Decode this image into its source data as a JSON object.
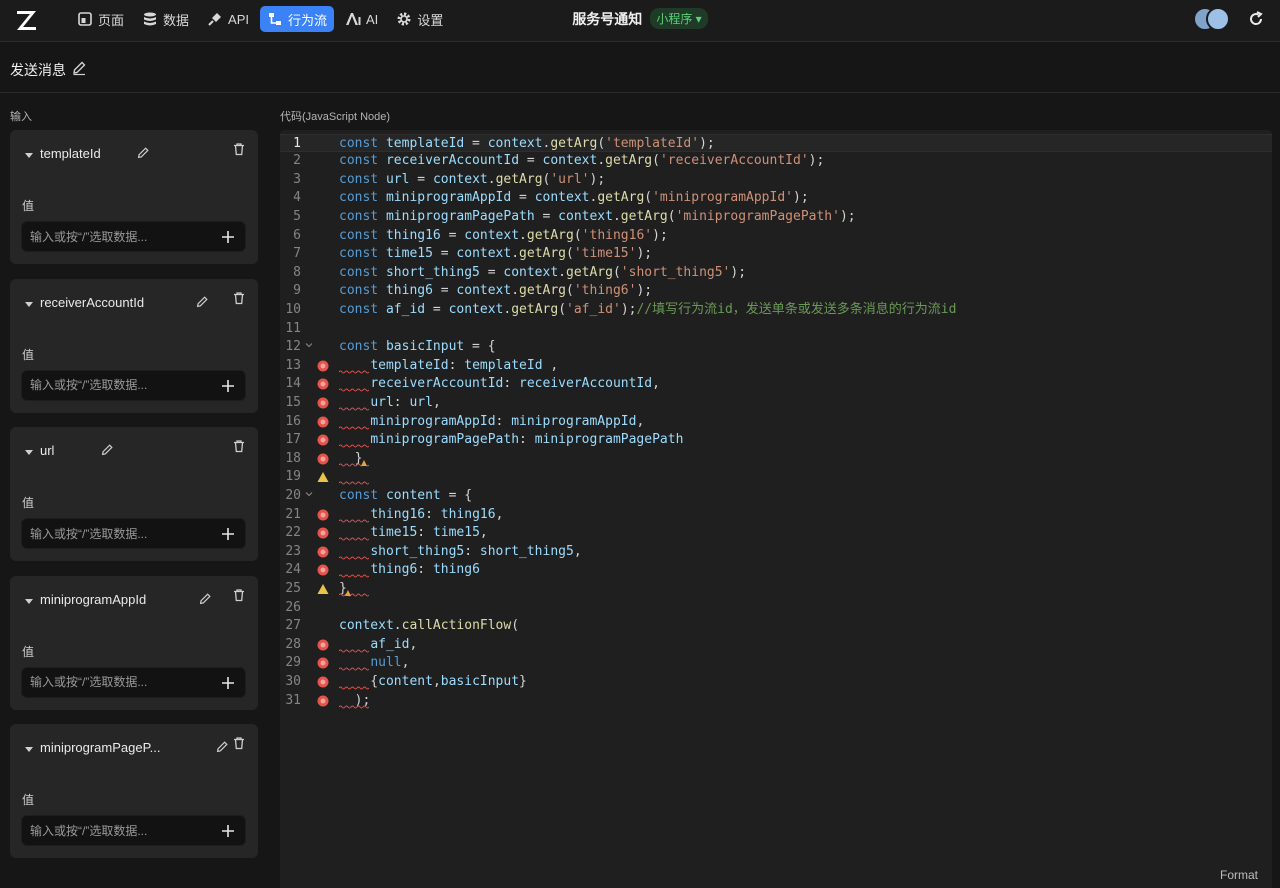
{
  "nav": {
    "items": [
      {
        "label": "页面",
        "icon": "page-icon"
      },
      {
        "label": "数据",
        "icon": "database-icon"
      },
      {
        "label": "API",
        "icon": "plug-icon"
      },
      {
        "label": "行为流",
        "icon": "flow-icon",
        "active": true
      },
      {
        "label": "AI",
        "icon": "ai-icon"
      },
      {
        "label": "设置",
        "icon": "gear-icon"
      }
    ]
  },
  "header": {
    "app_title": "服务号通知",
    "app_type": "小程序 ▾"
  },
  "page": {
    "title": "发送消息"
  },
  "inputs_section": {
    "label": "输入",
    "value_label": "值",
    "placeholder": "输入或按“/”选取数据...",
    "params": [
      "templateId",
      "receiverAccountId",
      "url",
      "miniprogramAppId",
      "miniprogramPageP..."
    ]
  },
  "code_section": {
    "label": "代码(JavaScript Node)",
    "format_label": "Format"
  },
  "code": {
    "current_line": 1,
    "lines": [
      {
        "n": "1",
        "m": "",
        "f": false,
        "t": [
          [
            "kw",
            "const"
          ],
          [
            "v",
            " templateId"
          ],
          [
            "pl",
            " = "
          ],
          [
            "v",
            "context"
          ],
          [
            "pl",
            "."
          ],
          [
            "fn",
            "getArg"
          ],
          [
            "pl",
            "("
          ],
          [
            "str",
            "'templateId'"
          ],
          [
            "pl",
            ");"
          ]
        ]
      },
      {
        "n": "2",
        "m": "",
        "f": false,
        "t": [
          [
            "kw",
            "const"
          ],
          [
            "v",
            " receiverAccountId"
          ],
          [
            "pl",
            " = "
          ],
          [
            "v",
            "context"
          ],
          [
            "pl",
            "."
          ],
          [
            "fn",
            "getArg"
          ],
          [
            "pl",
            "("
          ],
          [
            "str",
            "'receiverAccountId'"
          ],
          [
            "pl",
            ");"
          ]
        ]
      },
      {
        "n": "3",
        "m": "",
        "f": false,
        "t": [
          [
            "kw",
            "const"
          ],
          [
            "v",
            " url"
          ],
          [
            "pl",
            " = "
          ],
          [
            "v",
            "context"
          ],
          [
            "pl",
            "."
          ],
          [
            "fn",
            "getArg"
          ],
          [
            "pl",
            "("
          ],
          [
            "str",
            "'url'"
          ],
          [
            "pl",
            ");"
          ]
        ]
      },
      {
        "n": "4",
        "m": "",
        "f": false,
        "t": [
          [
            "kw",
            "const"
          ],
          [
            "v",
            " miniprogramAppId"
          ],
          [
            "pl",
            " = "
          ],
          [
            "v",
            "context"
          ],
          [
            "pl",
            "."
          ],
          [
            "fn",
            "getArg"
          ],
          [
            "pl",
            "("
          ],
          [
            "str",
            "'miniprogramAppId'"
          ],
          [
            "pl",
            ");"
          ]
        ]
      },
      {
        "n": "5",
        "m": "",
        "f": false,
        "t": [
          [
            "kw",
            "const"
          ],
          [
            "v",
            " miniprogramPagePath"
          ],
          [
            "pl",
            " = "
          ],
          [
            "v",
            "context"
          ],
          [
            "pl",
            "."
          ],
          [
            "fn",
            "getArg"
          ],
          [
            "pl",
            "("
          ],
          [
            "str",
            "'miniprogramPagePath'"
          ],
          [
            "pl",
            ");"
          ]
        ]
      },
      {
        "n": "6",
        "m": "",
        "f": false,
        "t": [
          [
            "kw",
            "const"
          ],
          [
            "v",
            " thing16"
          ],
          [
            "pl",
            " = "
          ],
          [
            "v",
            "context"
          ],
          [
            "pl",
            "."
          ],
          [
            "fn",
            "getArg"
          ],
          [
            "pl",
            "("
          ],
          [
            "str",
            "'thing16'"
          ],
          [
            "pl",
            ");"
          ]
        ]
      },
      {
        "n": "7",
        "m": "",
        "f": false,
        "t": [
          [
            "kw",
            "const"
          ],
          [
            "v",
            " time15"
          ],
          [
            "pl",
            " = "
          ],
          [
            "v",
            "context"
          ],
          [
            "pl",
            "."
          ],
          [
            "fn",
            "getArg"
          ],
          [
            "pl",
            "("
          ],
          [
            "str",
            "'time15'"
          ],
          [
            "pl",
            ");"
          ]
        ]
      },
      {
        "n": "8",
        "m": "",
        "f": false,
        "t": [
          [
            "kw",
            "const"
          ],
          [
            "v",
            " short_thing5"
          ],
          [
            "pl",
            " = "
          ],
          [
            "v",
            "context"
          ],
          [
            "pl",
            "."
          ],
          [
            "fn",
            "getArg"
          ],
          [
            "pl",
            "("
          ],
          [
            "str",
            "'short_thing5'"
          ],
          [
            "pl",
            ");"
          ]
        ]
      },
      {
        "n": "9",
        "m": "",
        "f": false,
        "t": [
          [
            "kw",
            "const"
          ],
          [
            "v",
            " thing6"
          ],
          [
            "pl",
            " = "
          ],
          [
            "v",
            "context"
          ],
          [
            "pl",
            "."
          ],
          [
            "fn",
            "getArg"
          ],
          [
            "pl",
            "("
          ],
          [
            "str",
            "'thing6'"
          ],
          [
            "pl",
            ");"
          ]
        ]
      },
      {
        "n": "10",
        "m": "",
        "f": false,
        "t": [
          [
            "kw",
            "const"
          ],
          [
            "v",
            " af_id"
          ],
          [
            "pl",
            " = "
          ],
          [
            "v",
            "context"
          ],
          [
            "pl",
            "."
          ],
          [
            "fn",
            "getArg"
          ],
          [
            "pl",
            "("
          ],
          [
            "str",
            "'af_id'"
          ],
          [
            "pl",
            ");"
          ],
          [
            "cm",
            "//填写行为流id，发送单条或发送多条消息的行为流id"
          ]
        ]
      },
      {
        "n": "11",
        "m": "",
        "f": false,
        "t": []
      },
      {
        "n": "12",
        "m": "",
        "f": true,
        "t": [
          [
            "kw",
            "const"
          ],
          [
            "v",
            " basicInput"
          ],
          [
            "pl",
            " = {"
          ]
        ]
      },
      {
        "n": "13",
        "m": "error",
        "f": false,
        "t": [
          [
            "pl",
            "    "
          ],
          [
            "v",
            "templateId"
          ],
          [
            "pl",
            ": "
          ],
          [
            "v",
            "templateId"
          ],
          [
            "pl",
            " ,"
          ]
        ]
      },
      {
        "n": "14",
        "m": "error",
        "f": false,
        "t": [
          [
            "pl",
            "    "
          ],
          [
            "v",
            "receiverAccountId"
          ],
          [
            "pl",
            ": "
          ],
          [
            "v",
            "receiverAccountId"
          ],
          [
            "pl",
            ","
          ]
        ]
      },
      {
        "n": "15",
        "m": "error",
        "f": false,
        "t": [
          [
            "pl",
            "    "
          ],
          [
            "v",
            "url"
          ],
          [
            "pl",
            ": "
          ],
          [
            "v",
            "url"
          ],
          [
            "pl",
            ","
          ]
        ]
      },
      {
        "n": "16",
        "m": "error",
        "f": false,
        "t": [
          [
            "pl",
            "    "
          ],
          [
            "v",
            "miniprogramAppId"
          ],
          [
            "pl",
            ": "
          ],
          [
            "v",
            "miniprogramAppId"
          ],
          [
            "pl",
            ","
          ]
        ]
      },
      {
        "n": "17",
        "m": "error",
        "f": false,
        "t": [
          [
            "pl",
            "    "
          ],
          [
            "v",
            "miniprogramPagePath"
          ],
          [
            "pl",
            ": "
          ],
          [
            "v",
            "miniprogramPagePath"
          ]
        ]
      },
      {
        "n": "18",
        "m": "error",
        "f": false,
        "t": [
          [
            "pl",
            "  }"
          ]
        ]
      },
      {
        "n": "19",
        "m": "warn",
        "f": false,
        "t": []
      },
      {
        "n": "20",
        "m": "",
        "f": true,
        "t": [
          [
            "kw",
            "const"
          ],
          [
            "v",
            " content"
          ],
          [
            "pl",
            " = {"
          ]
        ]
      },
      {
        "n": "21",
        "m": "error",
        "f": false,
        "t": [
          [
            "pl",
            "    "
          ],
          [
            "v",
            "thing16"
          ],
          [
            "pl",
            ": "
          ],
          [
            "v",
            "thing16"
          ],
          [
            "pl",
            ","
          ]
        ]
      },
      {
        "n": "22",
        "m": "error",
        "f": false,
        "t": [
          [
            "pl",
            "    "
          ],
          [
            "v",
            "time15"
          ],
          [
            "pl",
            ": "
          ],
          [
            "v",
            "time15"
          ],
          [
            "pl",
            ","
          ]
        ]
      },
      {
        "n": "23",
        "m": "error",
        "f": false,
        "t": [
          [
            "pl",
            "    "
          ],
          [
            "v",
            "short_thing5"
          ],
          [
            "pl",
            ": "
          ],
          [
            "v",
            "short_thing5"
          ],
          [
            "pl",
            ","
          ]
        ]
      },
      {
        "n": "24",
        "m": "error",
        "f": false,
        "t": [
          [
            "pl",
            "    "
          ],
          [
            "v",
            "thing6"
          ],
          [
            "pl",
            ": "
          ],
          [
            "v",
            "thing6"
          ]
        ]
      },
      {
        "n": "25",
        "m": "warn",
        "f": false,
        "t": [
          [
            "pl",
            "}"
          ]
        ]
      },
      {
        "n": "26",
        "m": "",
        "f": false,
        "t": []
      },
      {
        "n": "27",
        "m": "",
        "f": false,
        "t": [
          [
            "v",
            "context"
          ],
          [
            "pl",
            "."
          ],
          [
            "fn",
            "callActionFlow"
          ],
          [
            "pl",
            "("
          ]
        ]
      },
      {
        "n": "28",
        "m": "error",
        "f": false,
        "t": [
          [
            "pl",
            "    "
          ],
          [
            "v",
            "af_id"
          ],
          [
            "pl",
            ","
          ]
        ]
      },
      {
        "n": "29",
        "m": "error",
        "f": false,
        "t": [
          [
            "pl",
            "    "
          ],
          [
            "kw",
            "null"
          ],
          [
            "pl",
            ","
          ]
        ]
      },
      {
        "n": "30",
        "m": "error",
        "f": false,
        "t": [
          [
            "pl",
            "    {"
          ],
          [
            "v",
            "content"
          ],
          [
            "pl",
            ","
          ],
          [
            "v",
            "basicInput"
          ],
          [
            "pl",
            "}"
          ]
        ]
      },
      {
        "n": "31",
        "m": "error",
        "f": false,
        "t": [
          [
            "pl",
            "  );"
          ]
        ]
      }
    ]
  },
  "colors": {
    "accent": "#3b82f6",
    "tag_green": "#5bd17a",
    "error": "#e5534b",
    "warning": "#e8c547"
  }
}
